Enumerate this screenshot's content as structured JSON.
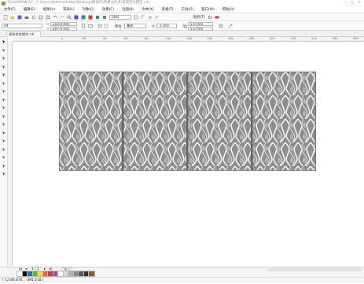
{
  "titlebar": {
    "title": "CorelDRAW X7 - C:\\Users\\Administrator\\Desktop\\原创作\\原建文件夹\\波浪花纹镂空.cdr"
  },
  "menu": [
    "文件(F)",
    "编辑(E)",
    "视图(V)",
    "布局(L)",
    "对象(C)",
    "效果(C)",
    "位图(B)",
    "文本(X)",
    "表格(T)",
    "工具(O)",
    "窗口(W)",
    "帮助(H)"
  ],
  "toolbar1": {
    "zoom": "56%",
    "snap": "贴齐(T)",
    "page_size": "A4"
  },
  "toolbar2": {
    "width": "210.0 mm",
    "height": "297.0 mm",
    "units_label": "单位:",
    "units": "毫米",
    "nudge": ".1 mm",
    "dup_x": "5.0 mm",
    "dup_y": "5.0 mm"
  },
  "doc_tab": "波浪花纹镂空.cdr",
  "ruler_ticks": [
    "0",
    "20",
    "40",
    "60",
    "80",
    "100",
    "120",
    "140",
    "160",
    "180",
    "200",
    "220",
    "240",
    "260",
    "280",
    "300"
  ],
  "page_nav": {
    "current": "1 / 1",
    "page_tab": "页 1"
  },
  "palette": [
    "#ffffff",
    "#000000",
    "#2a6fb5",
    "#5fb23a",
    "#e8e03a",
    "#e86a2a",
    "#d23a3a",
    "#9a4fb0",
    "#ffffff",
    "#d8d8d8",
    "#b0b0b0",
    "#888888",
    "#5a5a5a",
    "#333333",
    "#8b5a2b"
  ],
  "status": {
    "coords": "( 1,146.876 , -395.518 )"
  }
}
